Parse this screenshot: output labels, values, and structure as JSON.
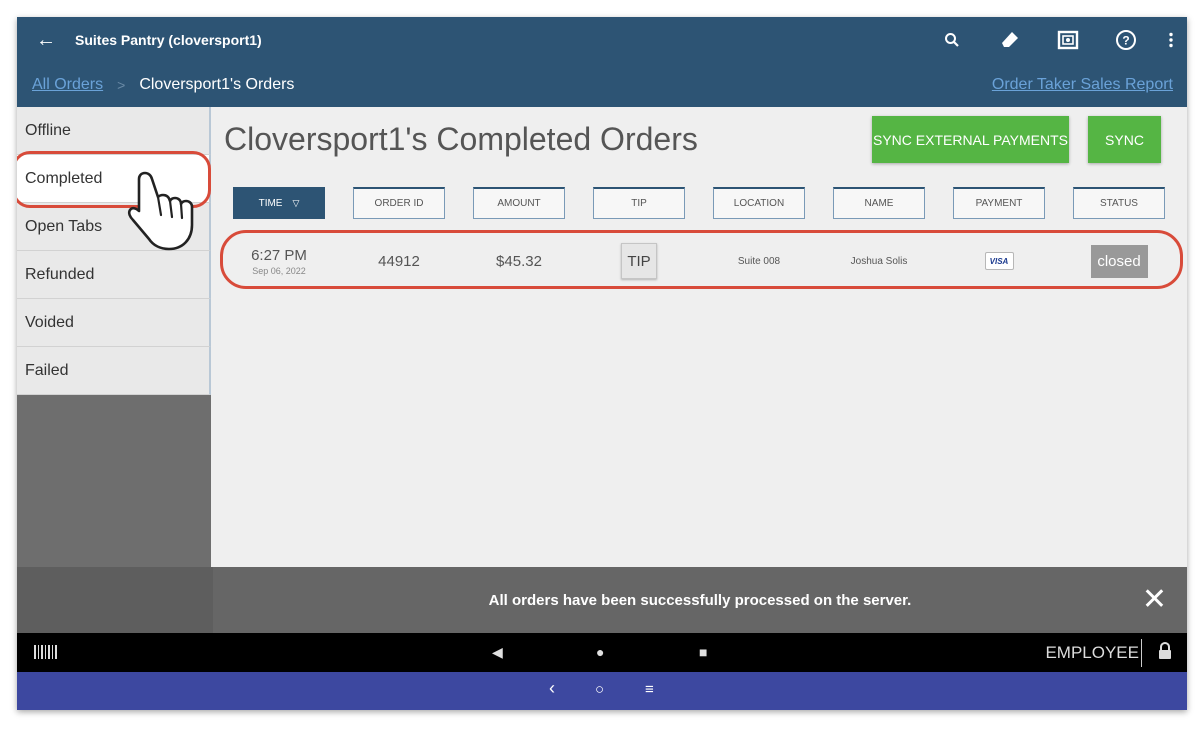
{
  "appbar": {
    "title": "Suites Pantry (cloversport1)",
    "back_icon": "arrow-left-icon",
    "actions": [
      "search-icon",
      "eraser-icon",
      "cash-drawer-icon",
      "help-icon",
      "more-vert-icon"
    ]
  },
  "breadcrumb": {
    "all_orders": "All Orders",
    "current": "Cloversport1's Orders",
    "report_link": "Order Taker Sales Report"
  },
  "sidebar": {
    "items": [
      {
        "label": "Offline"
      },
      {
        "label": "Completed"
      },
      {
        "label": "Open Tabs"
      },
      {
        "label": "Refunded"
      },
      {
        "label": "Voided"
      },
      {
        "label": "Failed"
      }
    ],
    "selected": "Completed"
  },
  "main": {
    "title": "Cloversport1's Completed Orders",
    "sync_external_label": "SYNC EXTERNAL PAYMENTS",
    "sync_label": "SYNC",
    "columns": [
      "TIME",
      "ORDER ID",
      "AMOUNT",
      "TIP",
      "LOCATION",
      "NAME",
      "PAYMENT",
      "STATUS"
    ],
    "orders": [
      {
        "time": "6:27 PM",
        "date": "Sep 06, 2022",
        "order_id": "44912",
        "amount": "$45.32",
        "tip_label": "TIP",
        "location": "Suite 008",
        "name": "Joshua Solis",
        "payment": "VISA",
        "status": "closed"
      }
    ]
  },
  "snackbar": {
    "message": "All orders have been successfully processed on the server.",
    "close_glyph": "✕"
  },
  "navbar": {
    "back_glyph": "◀",
    "home_glyph": "●",
    "recents_glyph": "■",
    "employee_label": "EMPLOYEE"
  },
  "bottombar": {
    "back_glyph": "‹",
    "home_glyph": "○",
    "menu_glyph": "≡"
  },
  "colors": {
    "header": "#2d5474",
    "green": "#55b544",
    "highlight": "#d84b3a",
    "system_bar": "#3d48a0"
  }
}
